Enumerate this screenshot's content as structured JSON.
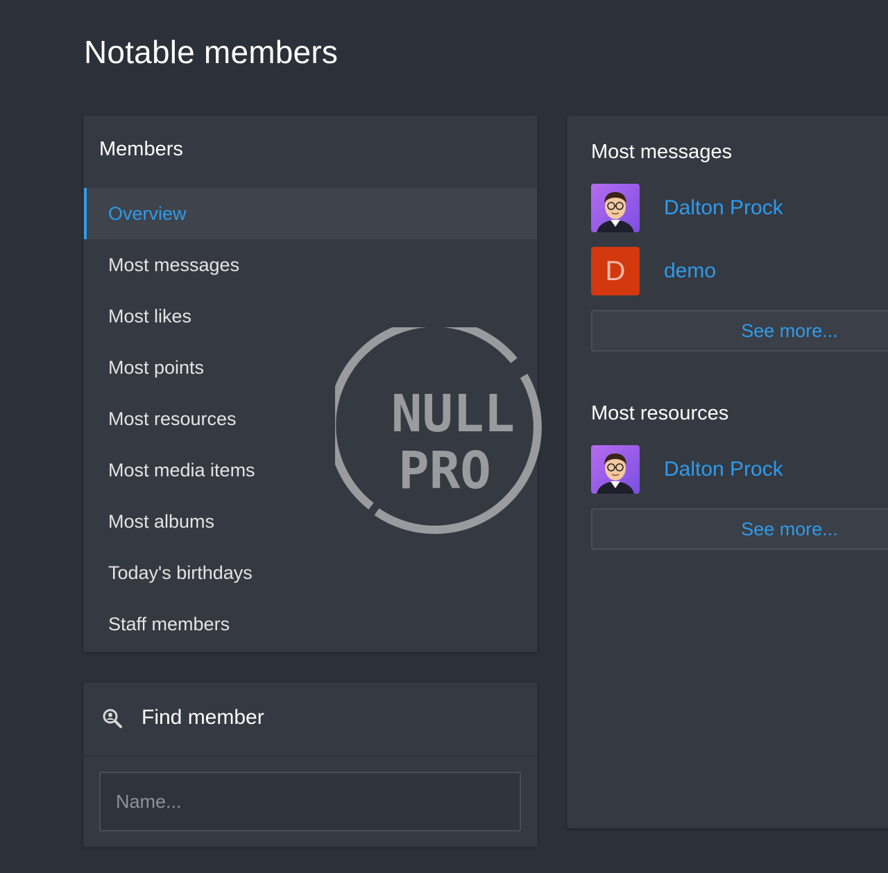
{
  "page": {
    "title": "Notable members"
  },
  "members_nav": {
    "header": "Members",
    "items": [
      {
        "label": "Overview",
        "selected": true
      },
      {
        "label": "Most messages",
        "selected": false
      },
      {
        "label": "Most likes",
        "selected": false
      },
      {
        "label": "Most points",
        "selected": false
      },
      {
        "label": "Most resources",
        "selected": false
      },
      {
        "label": "Most media items",
        "selected": false
      },
      {
        "label": "Most albums",
        "selected": false
      },
      {
        "label": "Today's birthdays",
        "selected": false
      },
      {
        "label": "Staff members",
        "selected": false
      }
    ]
  },
  "watermark": {
    "line1": "NULL",
    "line2": "PRO"
  },
  "find_member": {
    "title": "Find member",
    "icon": "search-icon",
    "input_placeholder": "Name..."
  },
  "most_messages": {
    "title": "Most messages",
    "members": [
      {
        "name": "Dalton Prock",
        "avatar": "photo-avatar"
      },
      {
        "name": "demo",
        "avatar_letter": "D",
        "avatar_color": "#d3380f"
      }
    ],
    "see_more": "See more..."
  },
  "most_resources": {
    "title": "Most resources",
    "members": [
      {
        "name": "Dalton Prock",
        "avatar": "photo-avatar"
      }
    ],
    "see_more": "See more..."
  },
  "colors": {
    "background": "#2c3039",
    "panel": "#353942",
    "accent": "#2f9bea"
  }
}
